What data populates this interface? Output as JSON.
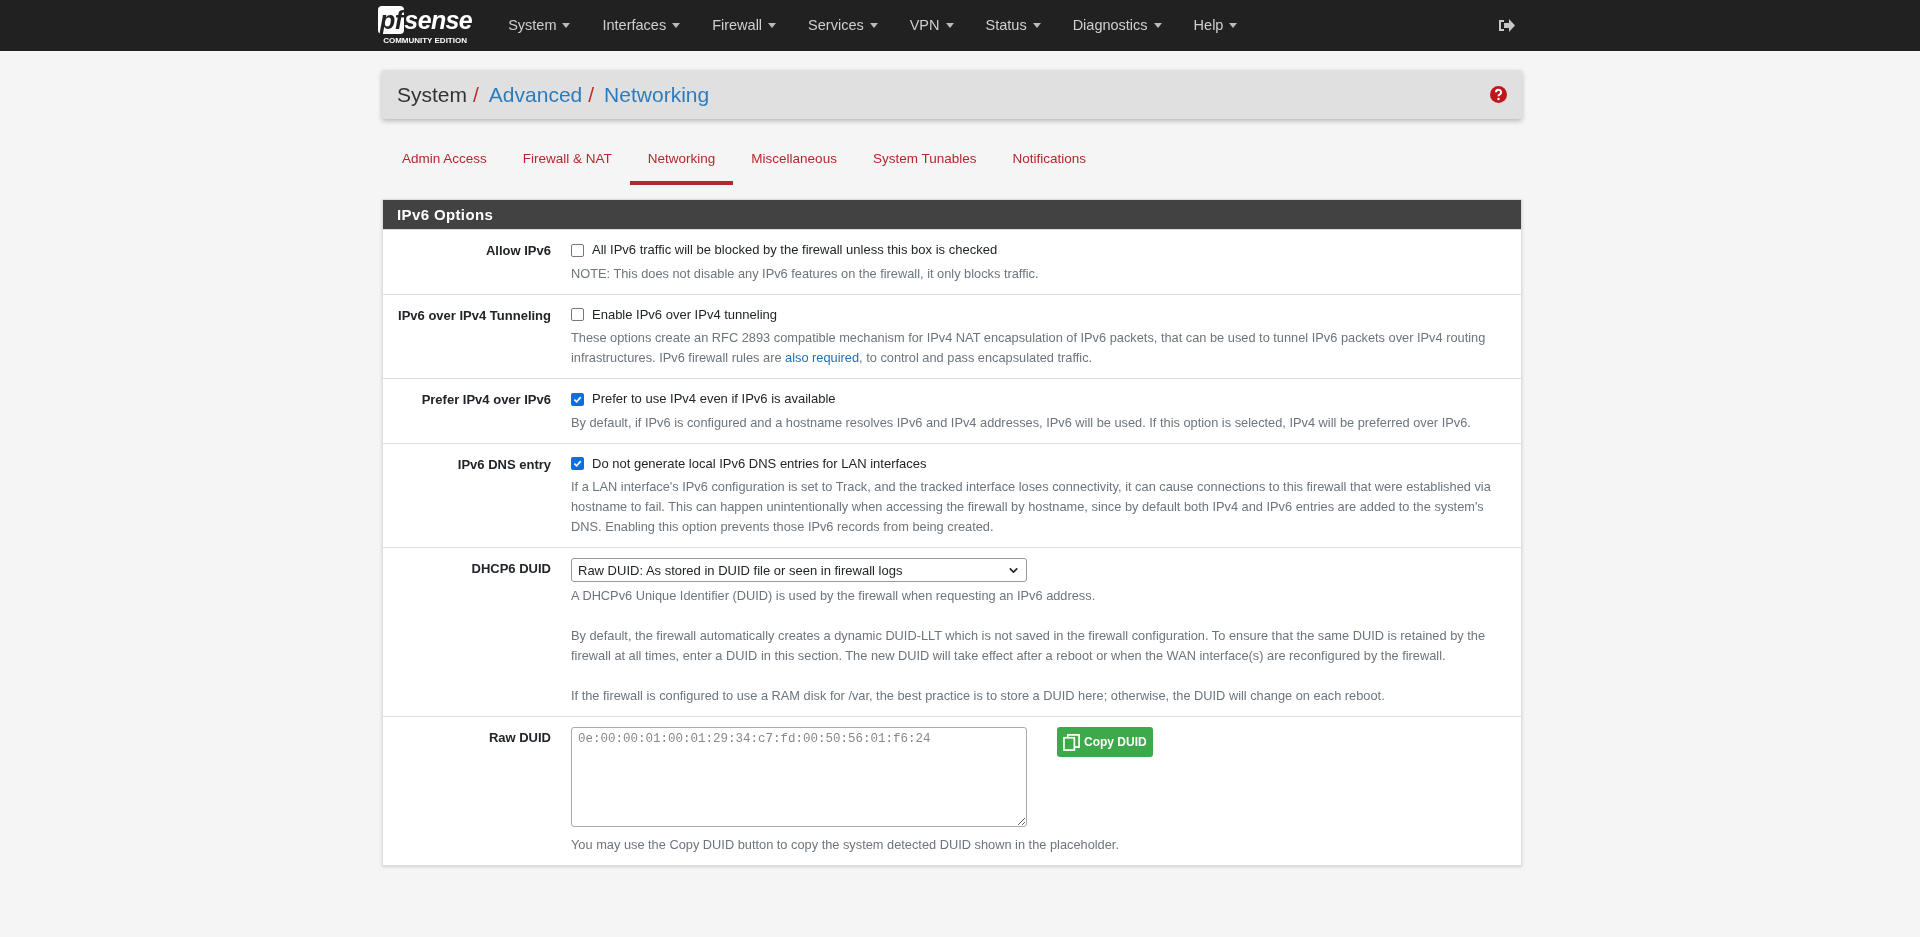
{
  "navbar": {
    "logo": {
      "brand": "sense",
      "brand_prefix": "pf",
      "edition": "COMMUNITY EDITION"
    },
    "menus": [
      {
        "label": "System"
      },
      {
        "label": "Interfaces"
      },
      {
        "label": "Firewall"
      },
      {
        "label": "Services"
      },
      {
        "label": "VPN"
      },
      {
        "label": "Status"
      },
      {
        "label": "Diagnostics"
      },
      {
        "label": "Help"
      }
    ]
  },
  "breadcrumb": {
    "root": "System",
    "links": [
      "Advanced",
      "Networking"
    ],
    "separator": "/"
  },
  "tabs": [
    {
      "label": "Admin Access",
      "selected": false
    },
    {
      "label": "Firewall & NAT",
      "selected": false
    },
    {
      "label": "Networking",
      "selected": true
    },
    {
      "label": "Miscellaneous",
      "selected": false
    },
    {
      "label": "System Tunables",
      "selected": false
    },
    {
      "label": "Notifications",
      "selected": false
    }
  ],
  "panel": {
    "title": "IPv6 Options",
    "rows": [
      {
        "kind": "checkbox",
        "label": "Allow IPv6",
        "checked": false,
        "option": "All IPv6 traffic will be blocked by the firewall unless this box is checked",
        "help": [
          "NOTE: This does not disable any IPv6 features on the firewall, it only blocks traffic."
        ]
      },
      {
        "kind": "checkbox",
        "label": "IPv6 over IPv4 Tunneling",
        "checked": false,
        "option": "Enable IPv6 over IPv4 tunneling",
        "help": [
          "These options create an RFC 2893 compatible mechanism for IPv4 NAT encapsulation of IPv6 packets, that can be used to tunnel IPv6 packets over IPv4 routing infrastructures. IPv6 firewall rules are"
        ],
        "help_link": "also required",
        "help_after": ", to control and pass encapsulated traffic."
      },
      {
        "kind": "checkbox",
        "label": "Prefer IPv4 over IPv6",
        "checked": true,
        "option": "Prefer to use IPv4 even if IPv6 is available",
        "help": [
          "By default, if IPv6 is configured and a hostname resolves IPv6 and IPv4 addresses, IPv6 will be used. If this option is selected, IPv4 will be preferred over IPv6."
        ]
      },
      {
        "kind": "checkbox",
        "label": "IPv6 DNS entry",
        "checked": true,
        "option": "Do not generate local IPv6 DNS entries for LAN interfaces",
        "help": [
          "If a LAN interface's IPv6 configuration is set to Track, and the tracked interface loses connectivity, it can cause connections to this firewall that were established via hostname to fail. This can happen unintentionally when accessing the firewall by hostname, since by default both IPv4 and IPv6 entries are added to the system's DNS. Enabling this option prevents those IPv6 records from being created."
        ]
      },
      {
        "kind": "select",
        "label": "DHCP6 DUID",
        "value": "Raw DUID: As stored in DUID file or seen in firewall logs",
        "help": [
          "A DHCPv6 Unique Identifier (DUID) is used by the firewall when requesting an IPv6 address.",
          "By default, the firewall automatically creates a dynamic DUID-LLT which is not saved in the firewall configuration. To ensure that the same DUID is retained by the firewall at all times, enter a DUID in this section. The new DUID will take effect after a reboot or when the WAN interface(s) are reconfigured by the firewall.",
          "If the firewall is configured to use a RAM disk for /var, the best practice is to store a DUID here; otherwise, the DUID will change on each reboot."
        ]
      },
      {
        "kind": "textarea",
        "label": "Raw DUID",
        "placeholder": "0e:00:00:01:00:01:29:34:c7:fd:00:50:56:01:f6:24",
        "button": "Copy DUID",
        "help": [
          "You may use the Copy DUID button to copy the system detected DUID shown in the placeholder."
        ]
      }
    ]
  }
}
